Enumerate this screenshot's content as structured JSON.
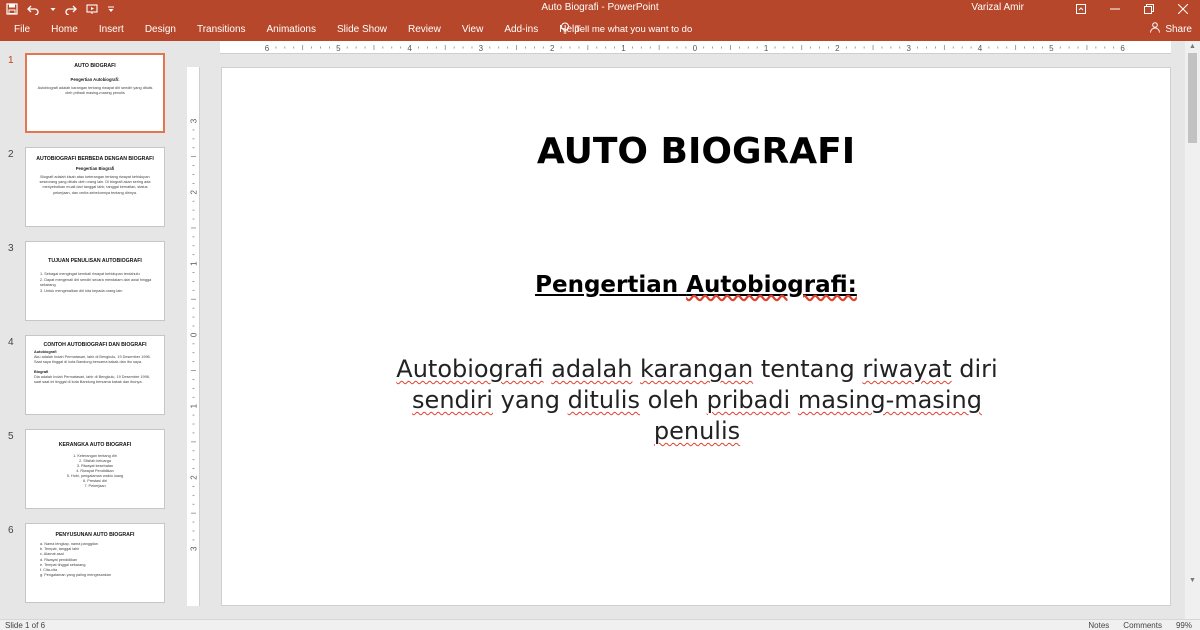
{
  "titlebar": {
    "doc_title": "Auto Biografi  -  PowerPoint",
    "user_name": "Varizal Amir"
  },
  "ribbon": {
    "tabs": [
      "File",
      "Home",
      "Insert",
      "Design",
      "Transitions",
      "Animations",
      "Slide Show",
      "Review",
      "View",
      "Add-ins",
      "Help"
    ],
    "tell_me": "Tell me what you want to do",
    "share": "Share"
  },
  "ruler": {
    "horizontal": [
      "6",
      "5",
      "4",
      "3",
      "2",
      "1",
      "0",
      "1",
      "2",
      "3",
      "4",
      "5",
      "6"
    ],
    "vertical": [
      "3",
      "2",
      "1",
      "0",
      "1",
      "2",
      "3"
    ]
  },
  "slides": [
    {
      "number": "1",
      "title": "AUTO BIOGRAFI",
      "subtitle": "Pengertian Autobiografi:",
      "body": "Autobiografi adalah karangan tentang riwayat diri sendiri yang ditulis oleh pribadi masing-masing penulis"
    },
    {
      "number": "2",
      "title": "AUTOBIOGRAFI BERBEDA DENGAN BIOGRAFI",
      "subtitle": "Pengertian Biografi",
      "body": "Biografi adalah kisah atau keterangan tentang riwayat kehidupan seseorang yang ditulis oleh orang lain. Di biografi akan sering ada menyebutkan muali dari tanggal lahir, tanggal kematian, status pekerjaan, dan cerita sebelumnya tentang dirinya."
    },
    {
      "number": "3",
      "title": "TUJUAN PENULISAN AUTOBIOGRAFI",
      "items": [
        "1. Sebagai mengingat kembali riwayat kehidupan terdahulu",
        "2. Dapat mengenali diri sendiri secara mendalam dari awal hingga sekarang",
        "3. Untuk mengenalkan diri kita kepada orang lain"
      ]
    },
    {
      "number": "4",
      "title": "CONTOH AUTOBIOGRAFI DAN BIOGRAFI",
      "label1": "Autobiografi",
      "text1": "Aku adalah Indah Permatasari, lahir di Bengkulu, 19 Desember 1996. Saat saya tinggal di kota Bandung bersama kakak dan ibu saya.",
      "label2": "Biografi",
      "text2": "Dia adalah Indah Permatasari, lahir di Bengkulu, 19 Desember 1996, saat saat ini tinggal di kota Bandung bersama kakak dan ibunya."
    },
    {
      "number": "5",
      "title": "KERANGKA AUTO BIOGRAFI",
      "items": [
        "1. Keterangan tentang diri",
        "2. Silsilah keluarga",
        "3. Riwayat kesehatan",
        "4. Riwayat Pendidikan",
        "5. Hobi, pengalaman waktu luang",
        "6. Prestasi diri",
        "7. Pekerjaan"
      ]
    },
    {
      "number": "6",
      "title": "PENYUSUNAN AUTO BIOGRAFI",
      "items": [
        "a. Nama lengkap, nama panggilan",
        "b. Tempat, tanggal lahir",
        "c. Alamat asal",
        "d. Riwayat pendidikan",
        "e. Tempat tinggal sekarang",
        "f. Cita-cita",
        "g. Pengalaman yang paling mengesankan"
      ]
    }
  ],
  "status": {
    "slide_info": "Slide 1 of 6",
    "notes": "Notes",
    "comments": "Comments",
    "zoom": "99%"
  },
  "colors": {
    "accent": "#b7472a",
    "selection": "#e3764e",
    "spellcheck": "#e0412f"
  }
}
